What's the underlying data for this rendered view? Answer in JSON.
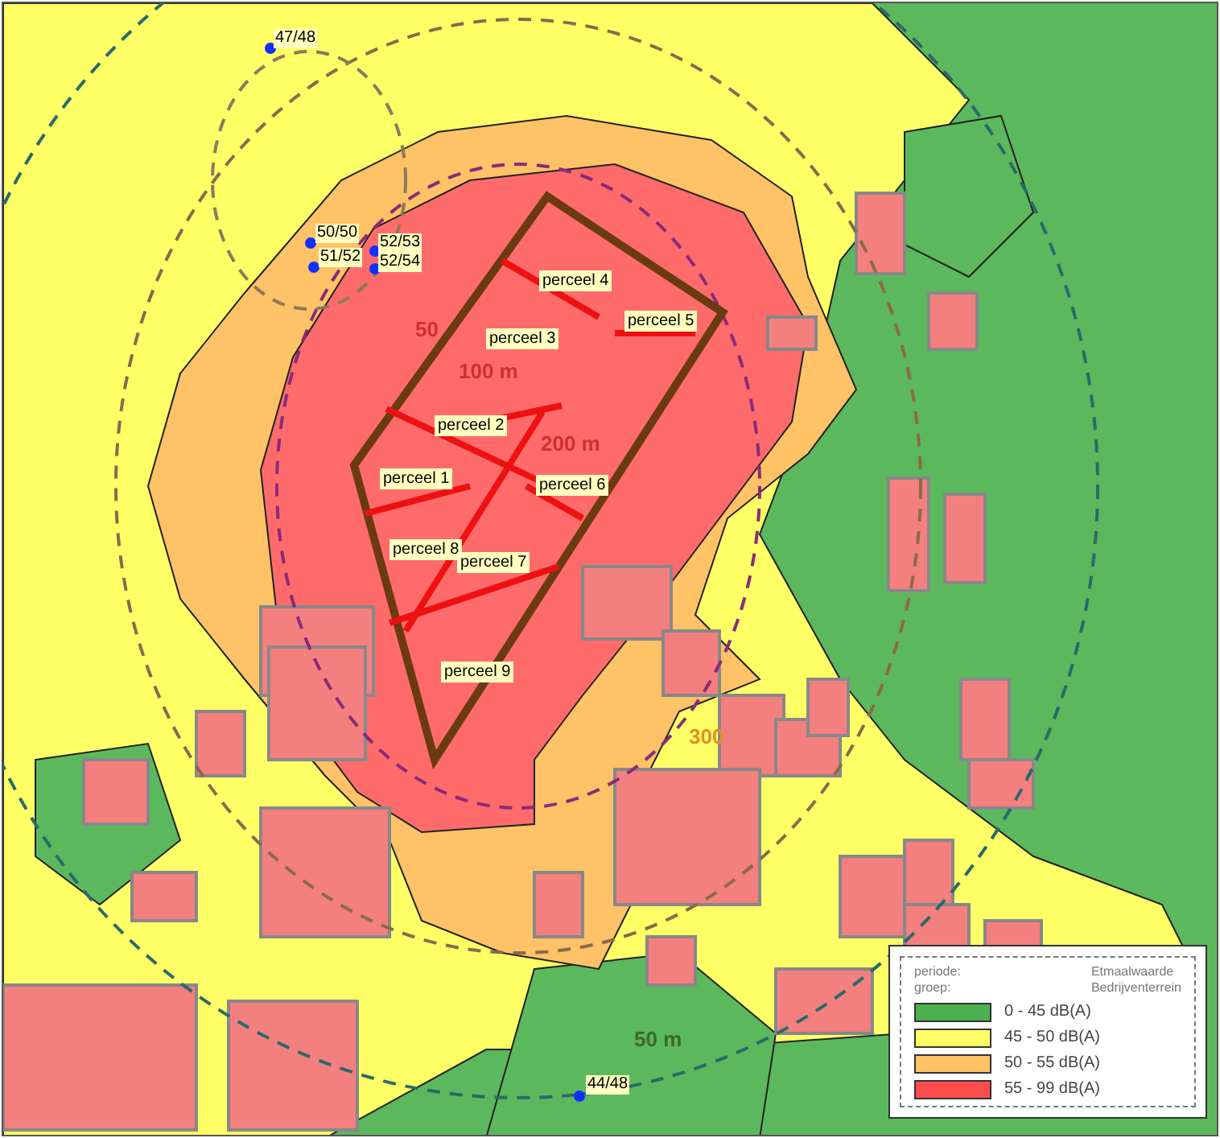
{
  "map": {
    "parcels": [
      {
        "label": "perceel 4"
      },
      {
        "label": "perceel 5"
      },
      {
        "label": "perceel 3"
      },
      {
        "label": "perceel 2"
      },
      {
        "label": "perceel 1"
      },
      {
        "label": "perceel 6"
      },
      {
        "label": "perceel 8"
      },
      {
        "label": "perceel 7"
      },
      {
        "label": "perceel 9"
      }
    ],
    "receptors": [
      {
        "label": "47/48"
      },
      {
        "label": "50/50"
      },
      {
        "label": "51/52"
      },
      {
        "label": "52/53"
      },
      {
        "label": "52/54"
      },
      {
        "label": "44/48"
      }
    ],
    "distance_labels": [
      {
        "label": "50",
        "color": "#d03030"
      },
      {
        "label": "100 m",
        "color": "#d03030"
      },
      {
        "label": "200 m",
        "color": "#d03030"
      },
      {
        "label": "300",
        "color": "#e0902a"
      },
      {
        "label": "50 m",
        "color": "#3a6a2a"
      }
    ]
  },
  "legend": {
    "period_label": "periode:",
    "group_label": "groep:",
    "period_value": "Etmaalwaarde",
    "group_value": "Bedrijventerrein",
    "items": [
      {
        "label": "0 - 45 dB(A)",
        "color": "#4caf50"
      },
      {
        "label": "45 - 50 dB(A)",
        "color": "#ffff66"
      },
      {
        "label": "50 - 55 dB(A)",
        "color": "#ffc266"
      },
      {
        "label": "55 - 99 dB(A)",
        "color": "#ff4d4d"
      }
    ]
  }
}
